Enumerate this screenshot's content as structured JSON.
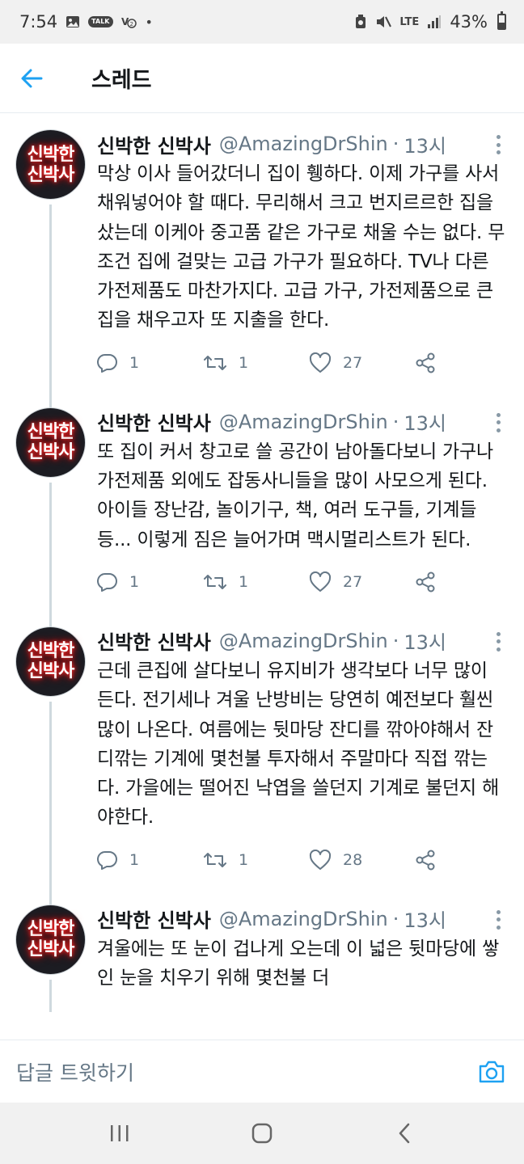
{
  "status_bar": {
    "time": "7:54",
    "network": "LTE",
    "battery": "43%",
    "battery_level": 0.43,
    "kakao_badge": "TALK",
    "left_icons": [
      "gallery-icon",
      "kakaotalk-icon",
      "volte-icon"
    ],
    "right_icons": [
      "recycle-icon",
      "mute-icon",
      "lte-icon",
      "signal-icon",
      "battery-icon"
    ]
  },
  "header": {
    "title": "스레드",
    "back_icon": "back-arrow-icon"
  },
  "tweets": [
    {
      "author": "신박한 신박사",
      "handle": "@AmazingDrShin",
      "time": "13시",
      "avatar_text": [
        "신박한",
        "신박사"
      ],
      "text": "막상 이사 들어갔더니 집이 휑하다. 이제 가구를 사서 채워넣어야 할 때다. 무리해서 크고 번지르르한 집을 샀는데 이케아 중고품 같은 가구로 채울 수는 없다. 무조건 집에 걸맞는 고급 가구가 필요하다. TV나 다른 가전제품도 마찬가지다. 고급 가구, 가전제품으로 큰 집을 채우고자 또 지출을 한다.",
      "replies": "1",
      "retweets": "1",
      "likes": "27"
    },
    {
      "author": "신박한 신박사",
      "handle": "@AmazingDrShin",
      "time": "13시",
      "avatar_text": [
        "신박한",
        "신박사"
      ],
      "text": "또 집이 커서 창고로 쓸 공간이 남아돌다보니 가구나 가전제품 외에도 잡동사니들을 많이 사모으게 된다. 아이들 장난감, 놀이기구, 책, 여러 도구들, 기계들 등... 이렇게 짐은 늘어가며 맥시멀리스트가 된다.",
      "replies": "1",
      "retweets": "1",
      "likes": "27"
    },
    {
      "author": "신박한 신박사",
      "handle": "@AmazingDrShin",
      "time": "13시",
      "avatar_text": [
        "신박한",
        "신박사"
      ],
      "text": "근데 큰집에 살다보니 유지비가 생각보다 너무 많이 든다. 전기세나 겨울 난방비는 당연히 예전보다 훨씬 많이 나온다. 여름에는 뒷마당 잔디를 깎아야해서 잔디깎는 기계에 몇천불 투자해서 주말마다 직접 깎는다. 가을에는 떨어진 낙엽을 쓸던지 기계로 불던지 해야한다.",
      "replies": "1",
      "retweets": "1",
      "likes": "28"
    },
    {
      "author": "신박한 신박사",
      "handle": "@AmazingDrShin",
      "time": "13시",
      "avatar_text": [
        "신박한",
        "신박사"
      ],
      "text": "겨울에는 또 눈이 겁나게 오는데 이 넓은 뒷마당에 쌓인 눈을 치우기 위해 몇천불 더",
      "replies": "",
      "retweets": "",
      "likes": ""
    }
  ],
  "reply_bar": {
    "placeholder": "답글 트윗하기",
    "camera_icon": "camera-icon"
  },
  "nav_bar": {
    "icons": [
      "recent-apps-icon",
      "home-icon",
      "back-icon"
    ]
  },
  "colors": {
    "accent": "#1da1f2",
    "text": "#14171a",
    "muted": "#657786",
    "divider": "#e6ecf0",
    "thread_line": "#cfd9de",
    "system_bar": "#f1f1f1"
  }
}
